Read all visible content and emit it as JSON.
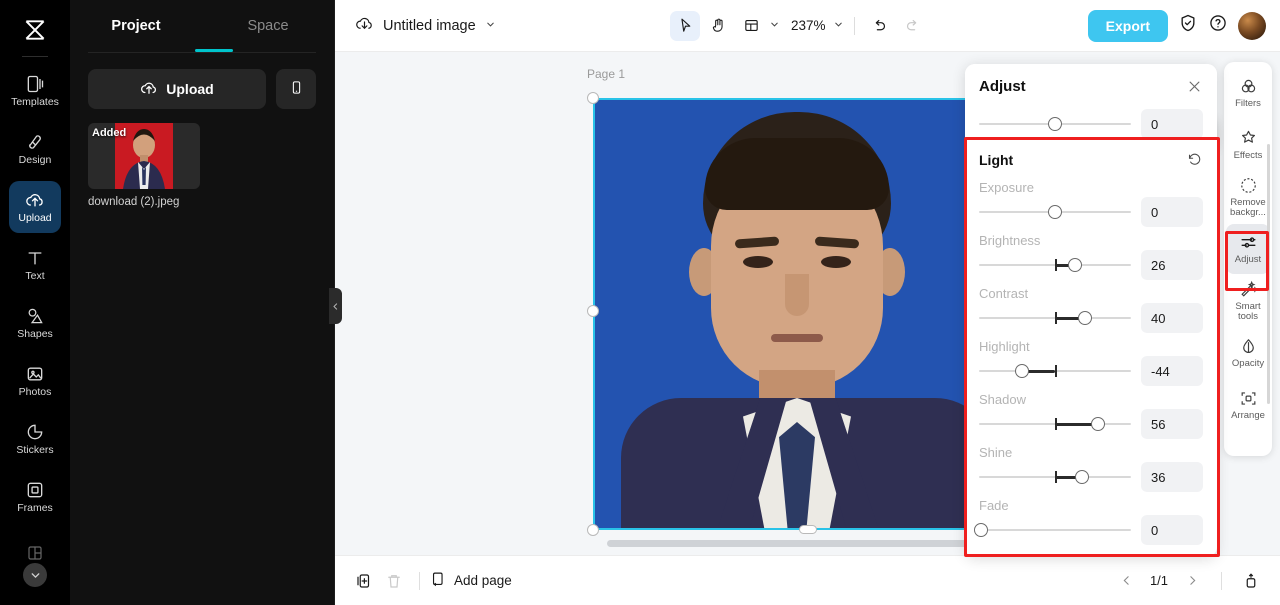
{
  "app": {
    "logo_icon": "capcut-logo-icon"
  },
  "left_rail": {
    "items": [
      {
        "label": "Templates",
        "icon": "templates-icon",
        "active": false
      },
      {
        "label": "Design",
        "icon": "design-icon",
        "active": false
      },
      {
        "label": "Upload",
        "icon": "upload-cloud-icon",
        "active": true
      },
      {
        "label": "Text",
        "icon": "text-icon",
        "active": false
      },
      {
        "label": "Shapes",
        "icon": "shapes-icon",
        "active": false
      },
      {
        "label": "Photos",
        "icon": "photos-icon",
        "active": false
      },
      {
        "label": "Stickers",
        "icon": "stickers-icon",
        "active": false
      },
      {
        "label": "Frames",
        "icon": "frames-icon",
        "active": false
      }
    ],
    "more_icon": "chevron-down-icon"
  },
  "left_panel": {
    "tabs": [
      {
        "label": "Project",
        "active": true
      },
      {
        "label": "Space",
        "active": false
      }
    ],
    "upload_button": "Upload",
    "upload_icon": "upload-cloud-icon",
    "phone_button_icon": "mobile-phone-icon",
    "asset": {
      "badge": "Added",
      "filename": "download (2).jpeg"
    },
    "collapse_icon": "chevron-left-icon"
  },
  "topbar": {
    "cloud_icon": "cloud-save-icon",
    "doc_title": "Untitled image",
    "doc_caret_icon": "chevron-down-icon",
    "tools": [
      {
        "name": "select-tool",
        "icon": "cursor-arrow-icon",
        "active": true
      },
      {
        "name": "hand-tool",
        "icon": "hand-icon",
        "active": false
      },
      {
        "name": "layout-tool",
        "icon": "layout-panel-icon",
        "active": false
      }
    ],
    "layout_caret_icon": "chevron-down-icon",
    "zoom_level": "237%",
    "zoom_caret_icon": "chevron-down-icon",
    "undo_icon": "undo-arrow-icon",
    "redo_icon": "redo-arrow-icon",
    "export_label": "Export",
    "shield_icon": "shield-check-icon",
    "help_icon": "question-circle-icon",
    "avatar_name": "user-avatar"
  },
  "canvas": {
    "page_label": "Page 1",
    "art_background_color": "#2353b0",
    "selection_color": "#29c3e8",
    "float_toolbar": [
      {
        "name": "crop-button",
        "icon": "crop-icon"
      },
      {
        "name": "flip-button",
        "icon": "flip-nodes-icon"
      },
      {
        "name": "duplicate-button",
        "icon": "duplicate-icon"
      },
      {
        "name": "more-button",
        "icon": "ellipsis-icon"
      }
    ]
  },
  "bottombar": {
    "duplicate_page_icon": "duplicate-page-icon",
    "delete_page_icon": "trash-icon",
    "add_page_label": "Add page",
    "add_page_icon": "add-page-icon",
    "prev_icon": "chevron-left-icon",
    "page_indicator": "1/1",
    "next_icon": "chevron-right-icon",
    "export_page_icon": "export-page-icon"
  },
  "adjust_panel": {
    "title": "Adjust",
    "close_icon": "close-icon",
    "partial_top_slider": {
      "value": "0",
      "knob_pct": 50
    },
    "section": {
      "title": "Light",
      "reset_icon": "reset-circular-arrow-icon",
      "rows": [
        {
          "label": "Exposure",
          "value": "0",
          "knob_pct": 50,
          "fill_from_pct": 50,
          "show_tick": false
        },
        {
          "label": "Brightness",
          "value": "26",
          "knob_pct": 63,
          "fill_from_pct": 50,
          "show_tick": true
        },
        {
          "label": "Contrast",
          "value": "40",
          "knob_pct": 69.5,
          "fill_from_pct": 50,
          "show_tick": true
        },
        {
          "label": "Highlight",
          "value": "-44",
          "knob_pct": 28,
          "fill_from_pct": 50,
          "show_tick": true
        },
        {
          "label": "Shadow",
          "value": "56",
          "knob_pct": 78,
          "fill_from_pct": 50,
          "show_tick": true
        },
        {
          "label": "Shine",
          "value": "36",
          "knob_pct": 68,
          "fill_from_pct": 50,
          "show_tick": true
        },
        {
          "label": "Fade",
          "value": "0",
          "knob_pct": 1,
          "fill_from_pct": 1,
          "show_tick": false
        }
      ]
    }
  },
  "right_rail": {
    "items": [
      {
        "label": "Filters",
        "icon": "filters-circles-icon",
        "active": false
      },
      {
        "label": "Effects",
        "icon": "effects-sparkle-icon",
        "active": false
      },
      {
        "label": "Remove\nbackgr...",
        "icon": "remove-background-icon",
        "active": false
      },
      {
        "label": "Adjust",
        "icon": "adjust-sliders-icon",
        "active": true
      },
      {
        "label": "Smart\ntools",
        "icon": "smart-tools-wand-icon",
        "active": false
      },
      {
        "label": "Opacity",
        "icon": "opacity-droplet-icon",
        "active": false
      },
      {
        "label": "Arrange",
        "icon": "arrange-icon",
        "active": false
      }
    ]
  },
  "annotations": {
    "color": "#ef1f1f",
    "boxes": [
      {
        "name": "light-section-highlight"
      },
      {
        "name": "adjust-tool-highlight"
      }
    ]
  }
}
